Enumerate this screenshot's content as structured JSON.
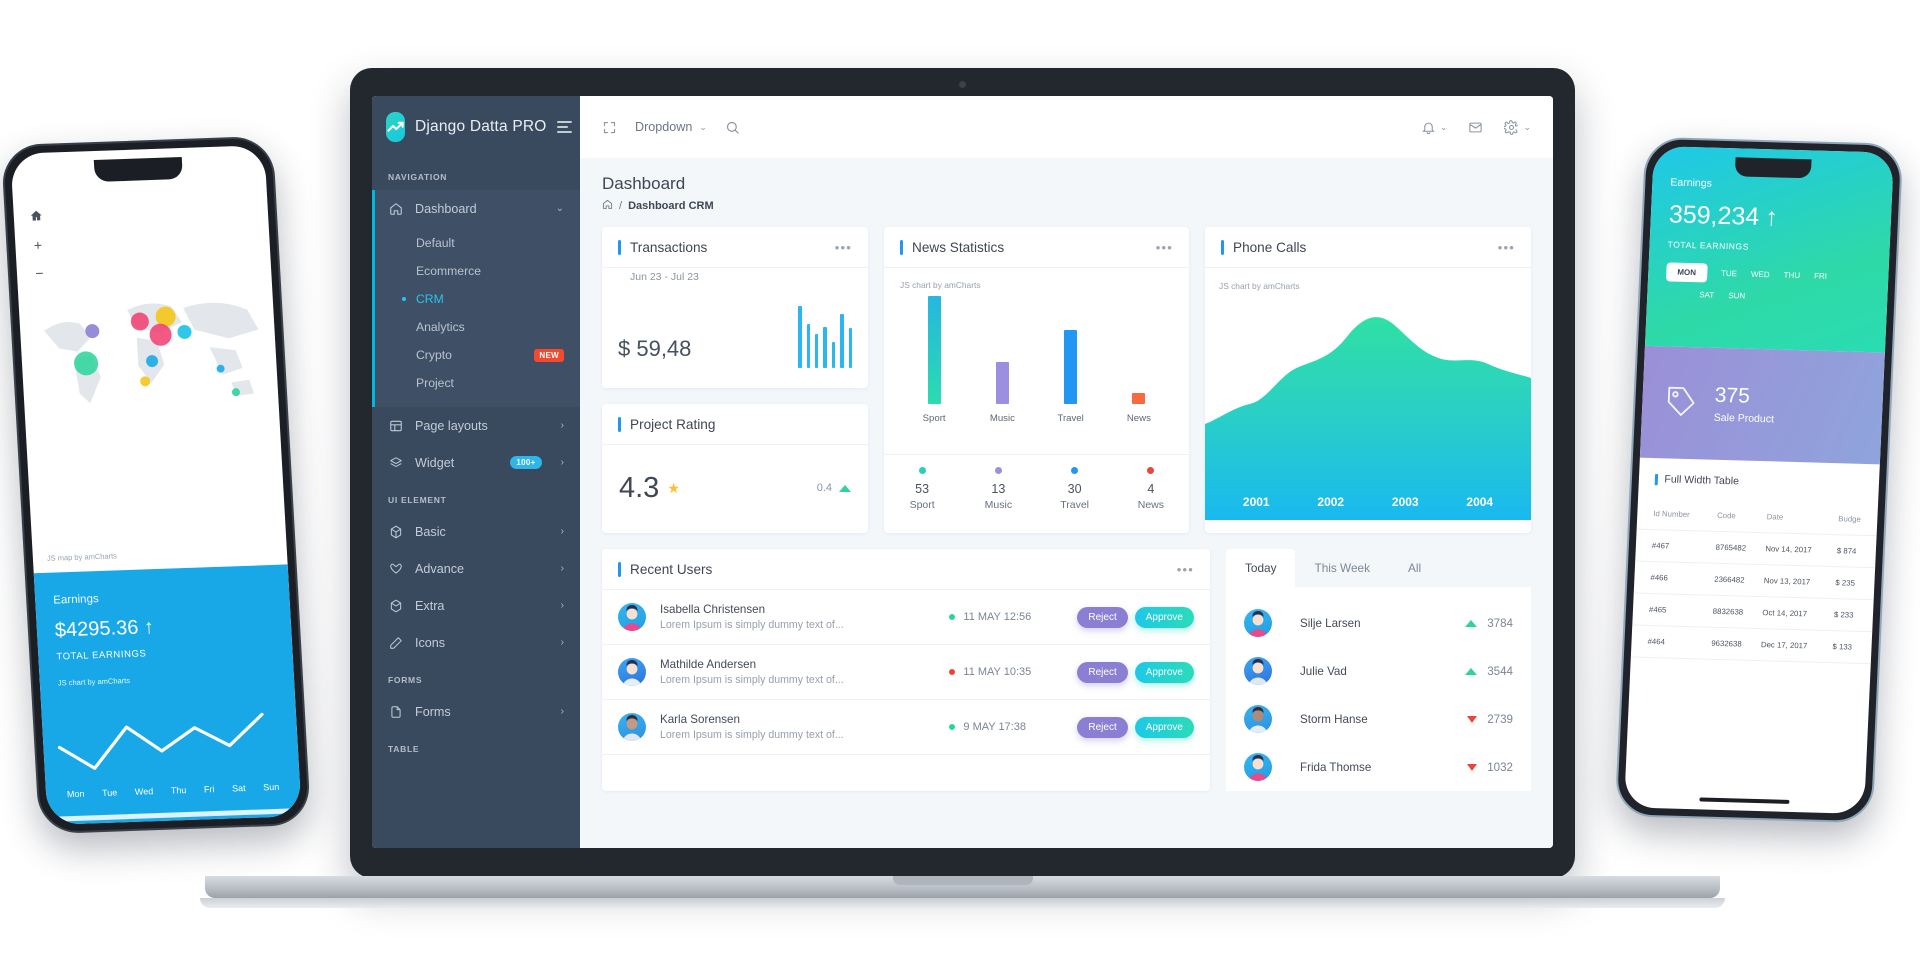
{
  "brand": {
    "title": "Django Datta PRO",
    "logo_icon": "trend-up-icon",
    "menu_icon": "hamburger-icon"
  },
  "sidebar": {
    "captions": {
      "navigation": "NAVIGATION",
      "ui_element": "UI ELEMENT",
      "forms": "FORMS",
      "table": "TABLE"
    },
    "dashboard": {
      "label": "Dashboard",
      "icon": "home-icon"
    },
    "dashboard_children": [
      {
        "label": "Default",
        "active": false,
        "badge": ""
      },
      {
        "label": "Ecommerce",
        "active": false,
        "badge": ""
      },
      {
        "label": "CRM",
        "active": true,
        "badge": ""
      },
      {
        "label": "Analytics",
        "active": false,
        "badge": ""
      },
      {
        "label": "Crypto",
        "active": false,
        "badge": "NEW"
      },
      {
        "label": "Project",
        "active": false,
        "badge": ""
      }
    ],
    "items": [
      {
        "label": "Page layouts",
        "icon": "layout-icon",
        "badge": ""
      },
      {
        "label": "Widget",
        "icon": "layers-icon",
        "badge": "100+"
      }
    ],
    "ui_items": [
      {
        "label": "Basic",
        "icon": "cube-icon"
      },
      {
        "label": "Advance",
        "icon": "heart-icon"
      },
      {
        "label": "Extra",
        "icon": "box-icon"
      },
      {
        "label": "Icons",
        "icon": "pen-icon"
      }
    ],
    "forms_items": [
      {
        "label": "Forms",
        "icon": "file-icon"
      }
    ]
  },
  "topbar": {
    "expand_icon": "expand-icon",
    "dropdown_label": "Dropdown",
    "chevron_icon": "chevron-down-icon",
    "search_icon": "search-icon",
    "bell_icon": "bell-icon",
    "mail_icon": "mail-icon",
    "gear_icon": "gear-icon"
  },
  "page": {
    "title": "Dashboard",
    "breadcrumb_home_icon": "home-icon",
    "breadcrumb_sep": "/",
    "breadcrumb_current": "Dashboard CRM"
  },
  "transactions": {
    "title": "Transactions",
    "subtitle": "Jun 23 - Jul 23",
    "amount": "$ 59,48",
    "more_icon": "more-icon"
  },
  "project_rating": {
    "title": "Project Rating",
    "value": "4.3",
    "star_icon": "star-icon",
    "delta": "0.4",
    "delta_dir": "up"
  },
  "news_statistics": {
    "title": "News Statistics",
    "more_icon": "more-icon",
    "credit": "JS chart by amCharts"
  },
  "phone_calls": {
    "title": "Phone Calls",
    "more_icon": "more-icon",
    "credit": "JS chart by amCharts"
  },
  "recent_users": {
    "title": "Recent Users",
    "more_icon": "more-icon",
    "reject_label": "Reject",
    "approve_label": "Approve",
    "rows": [
      {
        "name": "Isabella Christensen",
        "desc": "Lorem Ipsum is simply dummy text of...",
        "time": "11 MAY 12:56",
        "status": "#2ad49b"
      },
      {
        "name": "Mathilde Andersen",
        "desc": "Lorem Ipsum is simply dummy text of...",
        "time": "11 MAY 10:35",
        "status": "#f0443a"
      },
      {
        "name": "Karla Sorensen",
        "desc": "Lorem Ipsum is simply dummy text of...",
        "time": "9 MAY 17:38",
        "status": "#2ad49b"
      }
    ]
  },
  "leaderboard": {
    "tabs": [
      {
        "label": "Today",
        "active": true
      },
      {
        "label": "This Week",
        "active": false
      },
      {
        "label": "All",
        "active": false
      }
    ],
    "rows": [
      {
        "name": "Silje Larsen",
        "value": "3784",
        "dir": "up"
      },
      {
        "name": "Julie Vad",
        "value": "3544",
        "dir": "up"
      },
      {
        "name": "Storm Hanse",
        "value": "2739",
        "dir": "down"
      },
      {
        "name": "Frida Thomse",
        "value": "1032",
        "dir": "down"
      }
    ]
  },
  "phone_left": {
    "map_credit": "JS map by amCharts",
    "earnings_label": "Earnings",
    "amount": "$4295.36",
    "arrow": "↑",
    "total_label": "TOTAL EARNINGS",
    "chart_credit": "JS chart by amCharts",
    "days": [
      "Mon",
      "Tue",
      "Wed",
      "Thu",
      "Fri",
      "Sat",
      "Sun"
    ]
  },
  "phone_right": {
    "earnings_label": "Earnings",
    "amount": "359,234",
    "arrow": "↑",
    "total_label": "TOTAL EARNINGS",
    "days": [
      "MON",
      "TUE",
      "WED",
      "THU",
      "FRI",
      "SAT",
      "SUN"
    ],
    "active_day": "MON",
    "sale_number": "375",
    "sale_label": "Sale Product",
    "sale_icon": "tag-icon",
    "table_title": "Full Width Table",
    "table_headers": [
      "Id Number",
      "Code",
      "Date",
      "Budge"
    ],
    "table_rows": [
      [
        "#467",
        "8765482",
        "Nov 14, 2017",
        "$ 874"
      ],
      [
        "#466",
        "2366482",
        "Nov 13, 2017",
        "$ 235"
      ],
      [
        "#465",
        "8832638",
        "Oct 14, 2017",
        "$ 233"
      ],
      [
        "#464",
        "9632638",
        "Dec 17, 2017",
        "$ 133"
      ]
    ]
  },
  "chart_data": [
    {
      "type": "bar",
      "title": "Transactions",
      "name": "transactions-sparkline",
      "categories": [
        "1",
        "2",
        "3",
        "4",
        "5",
        "6",
        "7",
        "8"
      ],
      "values": [
        62,
        44,
        34,
        41,
        26,
        54,
        40,
        0
      ],
      "color": "#2ab6ef",
      "xlabel": "",
      "ylabel": "",
      "ylim": [
        0,
        68
      ]
    },
    {
      "type": "bar",
      "title": "News Statistics",
      "name": "news-statistics-bars",
      "categories": [
        "Sport",
        "Music",
        "Travel",
        "News"
      ],
      "values": [
        53,
        13,
        30,
        4
      ],
      "colors": [
        "#2ad0b6",
        "#9d8fdf",
        "#2196f3",
        "#f8693e"
      ],
      "xlabel": "",
      "ylabel": "",
      "ylim": [
        0,
        58
      ],
      "legend": [
        "Sport",
        "Music",
        "Travel",
        "News"
      ]
    },
    {
      "type": "area",
      "title": "Phone Calls",
      "name": "phone-calls-area",
      "x": [
        "2001",
        "2002",
        "2003",
        "2004"
      ],
      "values": [
        28,
        45,
        82,
        70
      ],
      "fill": "#2bd3b0",
      "xlabel": "",
      "ylabel": "",
      "ylim": [
        0,
        100
      ]
    },
    {
      "type": "line",
      "title": "Earnings",
      "name": "phone-left-earnings-line",
      "x": [
        "Mon",
        "Tue",
        "Wed",
        "Thu",
        "Fri",
        "Sat",
        "Sun"
      ],
      "values": [
        48,
        18,
        72,
        38,
        70,
        42,
        86
      ],
      "color": "#ffffff",
      "xlabel": "",
      "ylabel": "",
      "ylim": [
        0,
        100
      ]
    }
  ]
}
